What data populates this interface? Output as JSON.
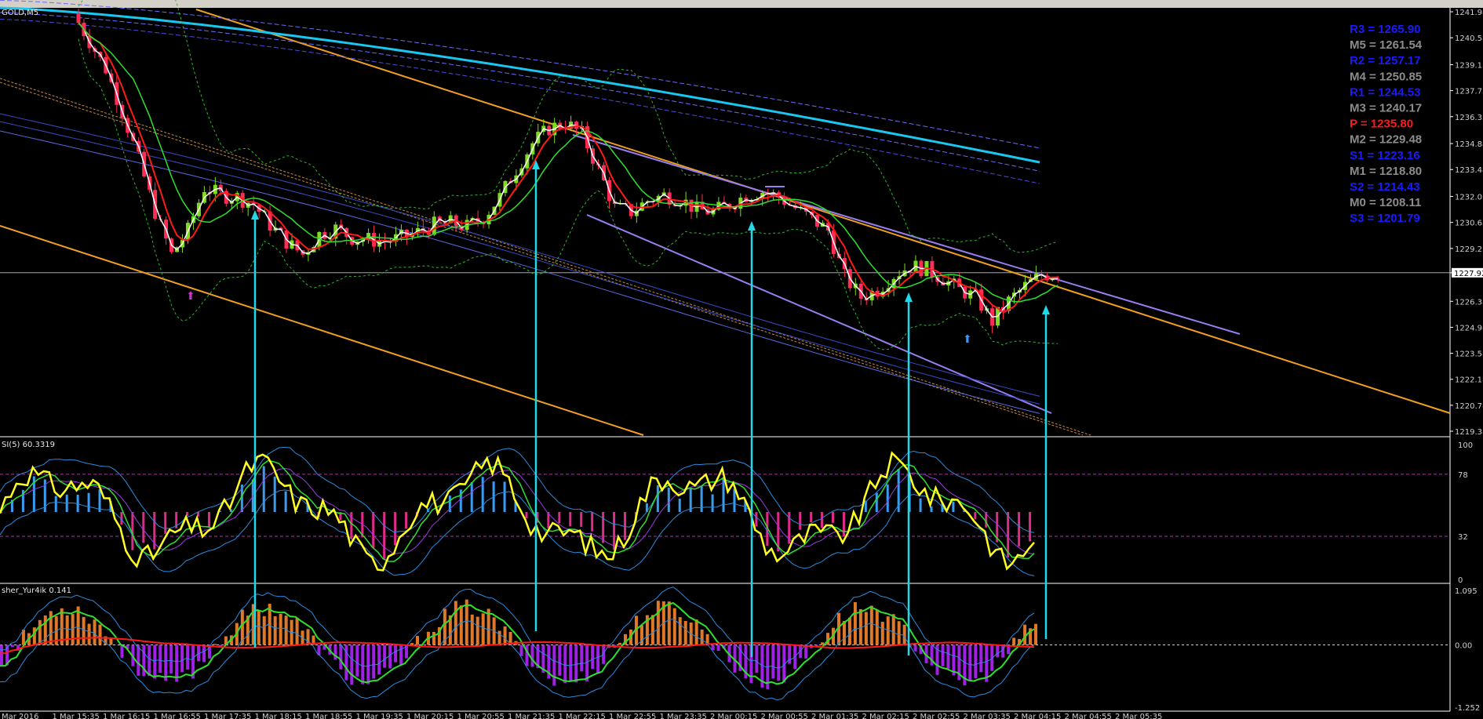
{
  "window": {
    "symbol_title": "GOLD,M5"
  },
  "indicators": {
    "rsi_title": "SI(5) 60.3319",
    "fisher_title": "sher_Yur4ik 0.141"
  },
  "pivots": [
    {
      "label": "R3 = 1265.90",
      "color": "#1a1aff"
    },
    {
      "label": "M5 = 1261.54",
      "color": "#8c8c8c"
    },
    {
      "label": "R2 = 1257.17",
      "color": "#1a1aff"
    },
    {
      "label": "M4 = 1250.85",
      "color": "#8c8c8c"
    },
    {
      "label": "R1 = 1244.53",
      "color": "#1a1aff"
    },
    {
      "label": "M3 = 1240.17",
      "color": "#8c8c8c"
    },
    {
      "label": "P   = 1235.80",
      "color": "#ff1a1a"
    },
    {
      "label": "M2 = 1229.48",
      "color": "#8c8c8c"
    },
    {
      "label": "S1 = 1223.16",
      "color": "#1a1aff"
    },
    {
      "label": "M1 = 1218.80",
      "color": "#8c8c8c"
    },
    {
      "label": "S2 = 1214.43",
      "color": "#1a1aff"
    },
    {
      "label": "M0 = 1208.11",
      "color": "#8c8c8c"
    },
    {
      "label": "S3 = 1201.79",
      "color": "#1a1aff"
    }
  ],
  "chart_data": {
    "type": "candlestick",
    "symbol": "GOLD",
    "timeframe": "M5",
    "price_axis": {
      "ticks": [
        "1241.98",
        "1240.58",
        "1239.13",
        "1237.73",
        "1236.33",
        "1234.88",
        "1233.48",
        "1232.03",
        "1230.63",
        "1229.23",
        "1227.92",
        "1226.38",
        "1224.98",
        "1223.58",
        "1222.18",
        "1220.78",
        "1219.38"
      ],
      "range": [
        1219.38,
        1241.98
      ],
      "current_price": "1227.92"
    },
    "rsi_axis": {
      "ticks": [
        "100",
        "78",
        "32",
        "0"
      ],
      "range": [
        0,
        100
      ],
      "levels": [
        78,
        32
      ]
    },
    "fisher_axis": {
      "ticks": [
        "1.095",
        "0.00",
        "-1.252"
      ],
      "range": [
        -1.252,
        1.095
      ]
    },
    "time_labels": [
      "Mar 2016",
      "1 Mar 15:35",
      "1 Mar 16:15",
      "1 Mar 16:55",
      "1 Mar 17:35",
      "1 Mar 18:15",
      "1 Mar 18:55",
      "1 Mar 19:35",
      "1 Mar 20:15",
      "1 Mar 20:55",
      "1 Mar 21:35",
      "1 Mar 22:15",
      "1 Mar 22:55",
      "1 Mar 23:35",
      "2 Mar 00:15",
      "2 Mar 00:55",
      "2 Mar 01:35",
      "2 Mar 02:15",
      "2 Mar 02:55",
      "2 Mar 03:35",
      "2 Mar 04:15",
      "2 Mar 04:55",
      "2 Mar 05:35"
    ],
    "close_path": [
      1241.9,
      1240.4,
      1238.9,
      1236.6,
      1234.0,
      1231.2,
      1228.9,
      1230.2,
      1232.5,
      1232.1,
      1232.0,
      1231.6,
      1230.5,
      1229.6,
      1228.9,
      1230.0,
      1230.3,
      1229.8,
      1229.7,
      1229.6,
      1229.8,
      1230.1,
      1230.5,
      1230.6,
      1230.4,
      1230.9,
      1232.0,
      1233.5,
      1234.9,
      1235.7,
      1236.0,
      1235.4,
      1233.5,
      1231.4,
      1231.2,
      1231.8,
      1232.1,
      1231.9,
      1231.3,
      1231.2,
      1231.6,
      1232.1,
      1232.3,
      1232.0,
      1231.4,
      1230.8,
      1230.2,
      1227.7,
      1226.6,
      1227.0,
      1227.8,
      1228.3,
      1228.1,
      1227.6,
      1227.0,
      1226.6,
      1225.3,
      1226.4,
      1227.2,
      1227.8,
      1227.9
    ],
    "arrows_x_times": [
      "1 Mar 18:15",
      "1 Mar 21:35",
      "2 Mar 00:55",
      "2 Mar 03:35",
      "2 Mar 05:35"
    ]
  }
}
